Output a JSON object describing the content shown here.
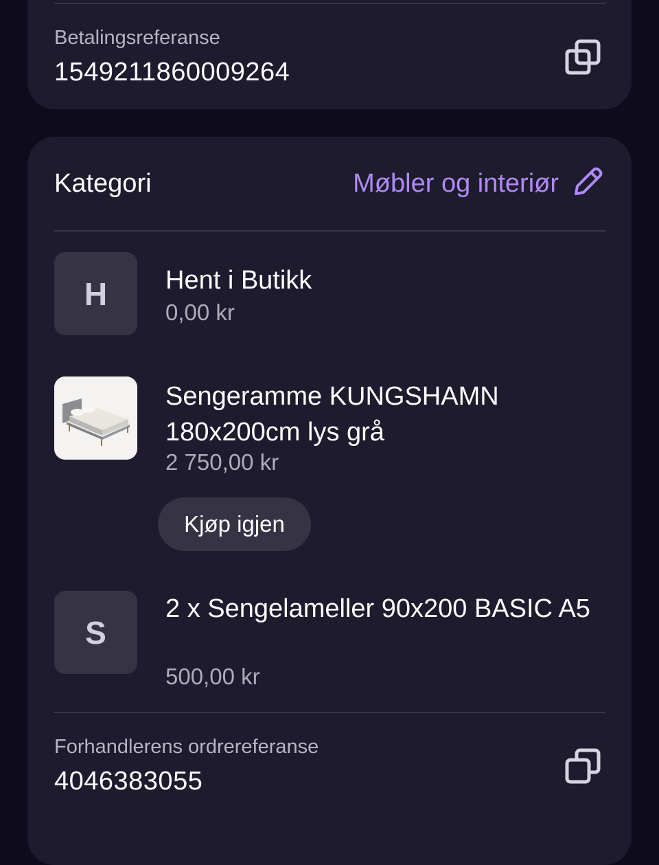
{
  "payment_ref": {
    "label": "Betalingsreferanse",
    "value": "1549211860009264",
    "copy_icon": "copy-icon"
  },
  "category": {
    "label": "Kategori",
    "value": "Møbler og interiør",
    "edit_icon": "pencil-icon",
    "accent_color": "#b08af5"
  },
  "items": [
    {
      "initial": "H",
      "title": "Hent i Butikk",
      "price": "0,00 kr"
    },
    {
      "image": "bed-frame-photo",
      "title": "Sengeramme KUNGSHAMN 180x200cm lys grå",
      "price": "2 750,00 kr",
      "action_label": "Kjøp igjen"
    },
    {
      "initial": "S",
      "title": "2 x Sengelameller 90x200 BASIC A5",
      "price": "500,00 kr"
    }
  ],
  "dealer_ref": {
    "label": "Forhandlerens ordrereferanse",
    "value": "4046383055",
    "copy_icon": "copy-icon"
  }
}
